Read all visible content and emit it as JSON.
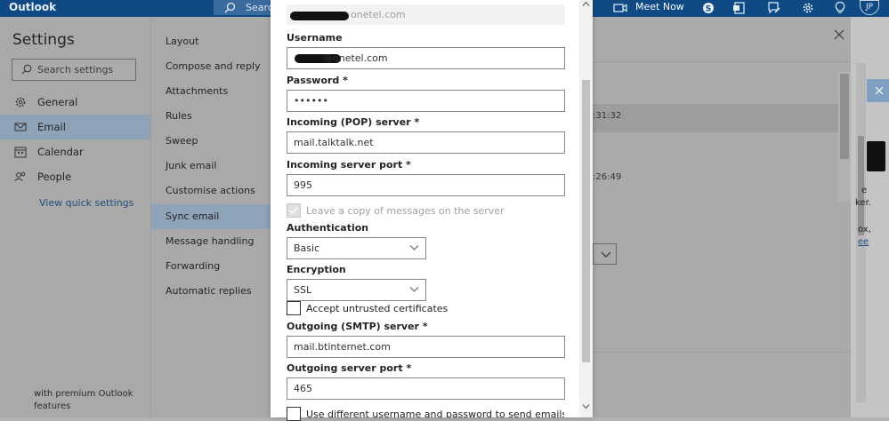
{
  "topbar": {
    "brand": "Outlook",
    "search_label": "Search",
    "meet_now": "Meet Now",
    "avatar_initials": "JP"
  },
  "settings": {
    "title": "Settings",
    "search_placeholder": "Search settings",
    "nav": [
      {
        "label": "General",
        "icon": "gear-icon"
      },
      {
        "label": "Email",
        "icon": "mail-icon"
      },
      {
        "label": "Calendar",
        "icon": "calendar-icon"
      },
      {
        "label": "People",
        "icon": "people-icon"
      }
    ],
    "quick_settings": "View quick settings",
    "promo": "with premium Outlook features",
    "subnav": [
      "Layout",
      "Compose and reply",
      "Attachments",
      "Rules",
      "Sweep",
      "Junk email",
      "Customise actions",
      "Sync email",
      "Message handling",
      "Forwarding",
      "Automatic replies"
    ]
  },
  "right_pane": {
    "time1": ":31:32",
    "time2": ":26:49",
    "far_right_text": [
      "e",
      "ker.",
      "ox,",
      "ee"
    ]
  },
  "form": {
    "top_value_tail": "onetel.com",
    "username_label": "Username",
    "username_tail": "@onetel.com",
    "password_label": "Password *",
    "password_value": "••••••",
    "incoming_server_label": "Incoming (POP) server *",
    "incoming_server_value": "mail.talktalk.net",
    "incoming_port_label": "Incoming server port *",
    "incoming_port_value": "995",
    "leave_copy_label": "Leave a copy of messages on the server",
    "authentication_label": "Authentication",
    "authentication_value": "Basic",
    "encryption_label": "Encryption",
    "encryption_value": "SSL",
    "accept_untrusted_label": "Accept untrusted certificates",
    "outgoing_server_label": "Outgoing (SMTP) server *",
    "outgoing_server_value": "mail.btinternet.com",
    "outgoing_port_label": "Outgoing server port *",
    "outgoing_port_value": "465",
    "different_credentials_label": "Use different username and password to send emails"
  }
}
